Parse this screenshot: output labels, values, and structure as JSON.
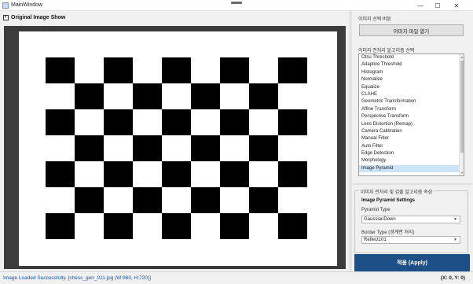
{
  "window": {
    "title": "MainWindow",
    "minimize": "—",
    "maximize": "☐",
    "close": "✕"
  },
  "left": {
    "show_original_label": "Original Image Show",
    "show_original_checked": true,
    "check_glyph": "✓"
  },
  "right": {
    "image_select_label": "이미지 선택 버튼",
    "open_button": "이미지 파일 열기",
    "algo_label": "이미지 전처리 알고리즘 선택",
    "algorithms": [
      "Otsu Threshold",
      "Adaptive Threshold",
      "Histogram",
      "Normalize",
      "Equalize",
      "CLAHE",
      "Geometric Transformation",
      "Affine Transform",
      "Perspective Transform",
      "Lens Distortion (Remap)",
      "Camera Calibration",
      "Manual Filter",
      "Auto Filter",
      "Edge Detection",
      "Morphology",
      "Image Pyramid"
    ],
    "selected_algorithm": "Image Pyramid",
    "properties_group": "이미지 전처리 및 검출 알고리즘 속성",
    "settings_title": "Image Pyramid Settings",
    "pyramid_type_label": "Pyramid Type",
    "pyramid_type_value": "GaussianDown",
    "border_type_label": "Border Type (경계면 처리)",
    "border_type_value": "Reflect101",
    "apply_button": "적용 (Apply)"
  },
  "status": {
    "message": "Image Loaded Successfully. [chess_gen_011.jpg (W:960, H:720)]",
    "coordinates": "(X: 0, Y: 0)"
  },
  "colors": {
    "accent": "#1c4f86",
    "status_text": "#1856a8",
    "selection": "#cce4f7"
  }
}
